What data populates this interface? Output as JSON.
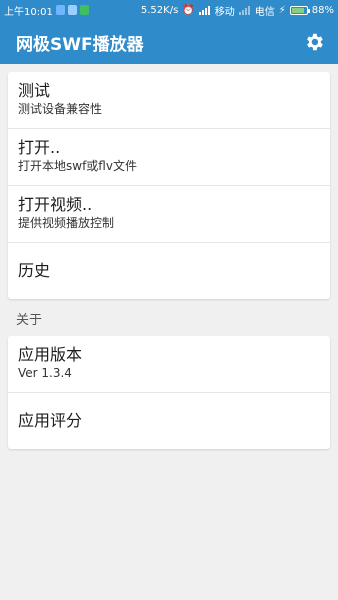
{
  "statusbar": {
    "time": "上午10:01",
    "network_speed": "5.52K/s",
    "carrier1": "移动",
    "carrier2": "电信",
    "battery_percent": "88%",
    "battery_level": 0.88
  },
  "appbar": {
    "title": "网极SWF播放器",
    "settings_icon": "gear-icon"
  },
  "main_menu": [
    {
      "title": "测试",
      "subtitle": "测试设备兼容性"
    },
    {
      "title": "打开..",
      "subtitle": "打开本地swf或flv文件"
    },
    {
      "title": "打开视频..",
      "subtitle": "提供视频播放控制"
    },
    {
      "title": "历史"
    }
  ],
  "about": {
    "section_label": "关于",
    "version_title": "应用版本",
    "version_value": "Ver 1.3.4",
    "rate_title": "应用评分"
  },
  "colors": {
    "primary": "#2f8bc9",
    "background": "#f0f0f0",
    "card": "#ffffff"
  }
}
